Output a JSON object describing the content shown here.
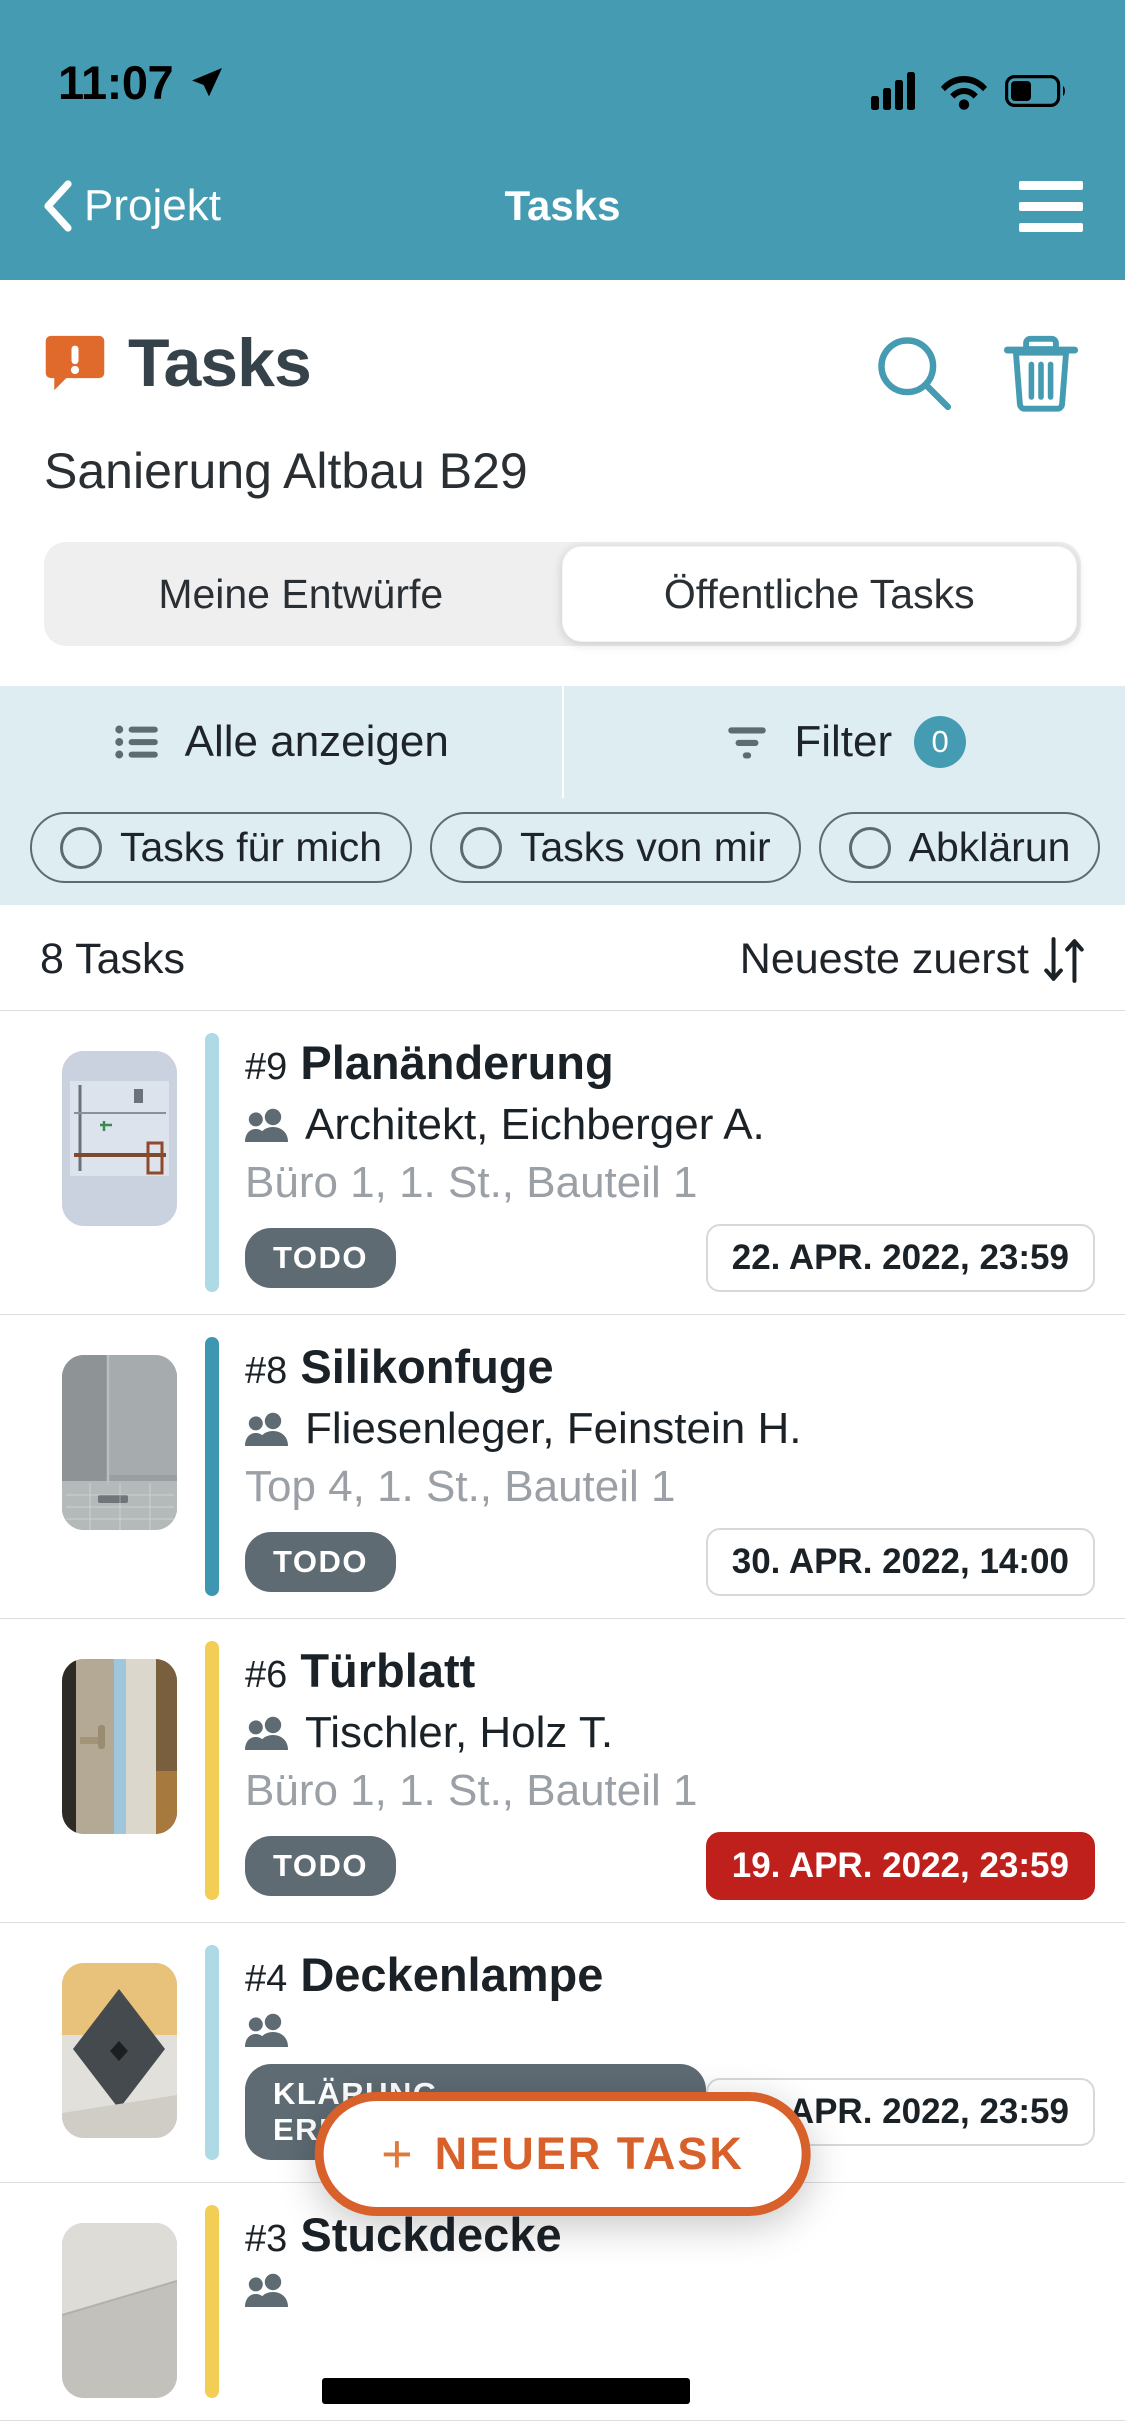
{
  "statusbar": {
    "time": "11:07",
    "location_icon": "location-arrow-icon",
    "signal_icon": "cellular-signal-icon",
    "wifi_icon": "wifi-icon",
    "battery_icon": "battery-icon"
  },
  "navbar": {
    "back_label": "Projekt",
    "back_icon": "chevron-left-icon",
    "title": "Tasks",
    "menu_icon": "hamburger-menu-icon"
  },
  "header": {
    "title": "Tasks",
    "title_icon": "orange-exclamation-bubble-icon",
    "subtitle": "Sanierung Altbau B29",
    "search_icon": "search-icon",
    "delete_icon": "trash-icon"
  },
  "segmented": {
    "options": [
      {
        "label": "Meine Entwürfe",
        "selected": false
      },
      {
        "label": "Öffentliche Tasks",
        "selected": true
      }
    ]
  },
  "filterbar": {
    "show_all_label": "Alle anzeigen",
    "show_all_icon": "list-icon",
    "filter_label": "Filter",
    "filter_icon": "funnel-icon",
    "filter_count": "0"
  },
  "chips": [
    {
      "label": "Tasks für mich",
      "icon": "radio-circle-icon",
      "selected": false
    },
    {
      "label": "Tasks von mir",
      "icon": "radio-circle-icon",
      "selected": false
    },
    {
      "label": "Abklärun",
      "icon": "radio-circle-icon",
      "selected": false
    }
  ],
  "listheader": {
    "count_label": "8 Tasks",
    "sort_label": "Neueste zuerst",
    "sort_icon": "sort-updown-icon"
  },
  "tasks": [
    {
      "number": "#9",
      "name": "Planänderung",
      "assignee": "Architekt, Eichberger A.",
      "assignee_icon": "people-icon",
      "location": "Büro 1, 1. St., Bauteil 1",
      "status": "TODO",
      "date": "22. APR. 2022, 23:59",
      "overdue": false,
      "accent_color": "#AEDAE6",
      "thumb": "floorplan-thumbnail"
    },
    {
      "number": "#8",
      "name": "Silikonfuge",
      "assignee": "Fliesenleger, Feinstein H.",
      "assignee_icon": "people-icon",
      "location": "Top 4, 1. St., Bauteil 1",
      "status": "TODO",
      "date": "30. APR. 2022, 14:00",
      "overdue": false,
      "accent_color": "#3E97B0",
      "thumb": "shower-tile-thumbnail"
    },
    {
      "number": "#6",
      "name": "Türblatt",
      "assignee": "Tischler, Holz T.",
      "assignee_icon": "people-icon",
      "location": "Büro 1, 1. St., Bauteil 1",
      "status": "TODO",
      "date": "19. APR. 2022, 23:59",
      "overdue": true,
      "accent_color": "#F3CE55",
      "thumb": "door-thumbnail"
    },
    {
      "number": "#4",
      "name": "Deckenlampe",
      "assignee": "",
      "assignee_icon": "people-icon",
      "location": "",
      "status": "KLÄRUNG ERFORDERLICH",
      "date": "30. APR. 2022, 23:59",
      "overdue": false,
      "accent_color": "#AEDAE6",
      "thumb": "ceiling-lamp-thumbnail"
    },
    {
      "number": "#3",
      "name": "Stuckdecke",
      "assignee": "",
      "assignee_icon": "people-icon",
      "location": "",
      "status": "",
      "date": "",
      "overdue": false,
      "accent_color": "#F3CE55",
      "thumb": "stucco-ceiling-thumbnail"
    }
  ],
  "fab": {
    "label": "NEUER TASK",
    "plus_icon": "plus-icon"
  },
  "colors": {
    "brand_teal": "#459CB2",
    "accent_orange": "#D8602A",
    "overdue_red": "#C0201C",
    "status_gray": "#5E6B73",
    "filter_bg": "#DDEDF2"
  }
}
